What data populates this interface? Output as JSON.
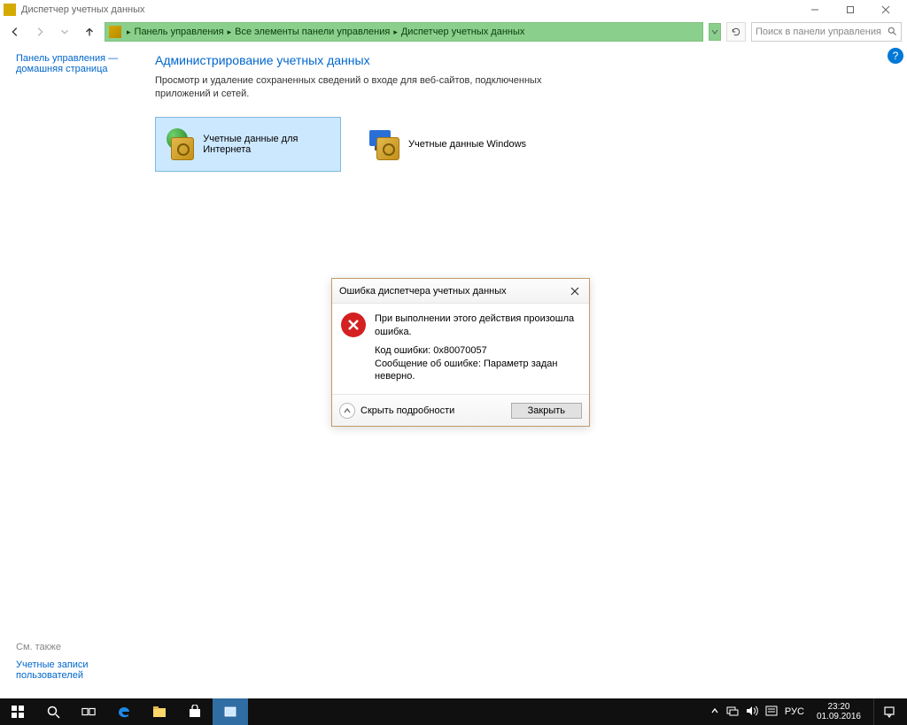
{
  "window": {
    "title": "Диспетчер учетных данных"
  },
  "toolbar": {
    "breadcrumb": [
      "Панель управления",
      "Все элементы панели управления",
      "Диспетчер учетных данных"
    ],
    "search_placeholder": "Поиск в панели управления"
  },
  "sidebar": {
    "home_line1": "Панель управления —",
    "home_line2": "домашняя страница",
    "see_also": "См. также",
    "user_accounts_line1": "Учетные записи",
    "user_accounts_line2": "пользователей"
  },
  "main": {
    "heading": "Администрирование учетных данных",
    "description": "Просмотр и удаление сохраненных сведений о входе для веб-сайтов, подключенных приложений и сетей.",
    "card_web": "Учетные данные для Интернета",
    "card_windows": "Учетные данные Windows"
  },
  "dialog": {
    "title": "Ошибка диспетчера учетных данных",
    "msg": "При выполнении этого действия произошла ошибка.",
    "code_label": "Код ошибки: 0x80070057",
    "err_label": "Сообщение об ошибке: Параметр задан неверно.",
    "hide_details": "Скрыть подробности",
    "close": "Закрыть"
  },
  "taskbar": {
    "lang": "РУС",
    "time": "23:20",
    "date": "01.09.2016"
  }
}
